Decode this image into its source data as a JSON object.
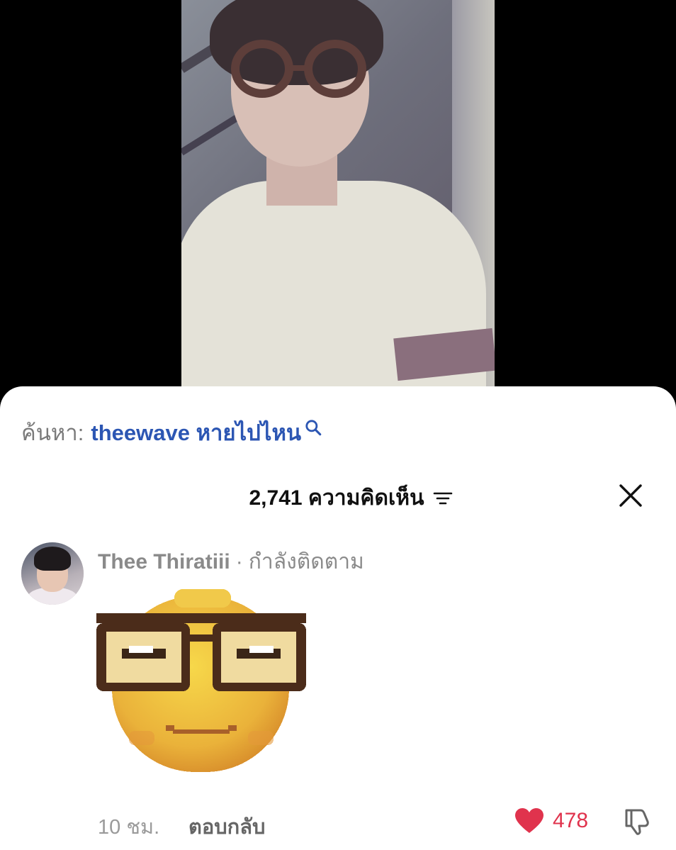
{
  "search": {
    "prefix": "ค้นหา:",
    "query": "theewave หายไปไหน"
  },
  "comments_header": {
    "count_label": "2,741 ความคิดเห็น"
  },
  "comment": {
    "username": "Thee Thiratiii",
    "separator": "·",
    "follow_status": "กำลังติดตาม",
    "timestamp": "10 ชม.",
    "reply_label": "ตอบกลับ",
    "like_count": "478"
  },
  "colors": {
    "link_blue": "#2c56b3",
    "heart_red": "#e0334d",
    "muted_gray": "#8a8a8a"
  },
  "icons": {
    "search": "search-icon",
    "filter": "filter-icon",
    "close": "close-icon",
    "like": "heart-icon",
    "dislike": "thumbs-down-icon"
  }
}
